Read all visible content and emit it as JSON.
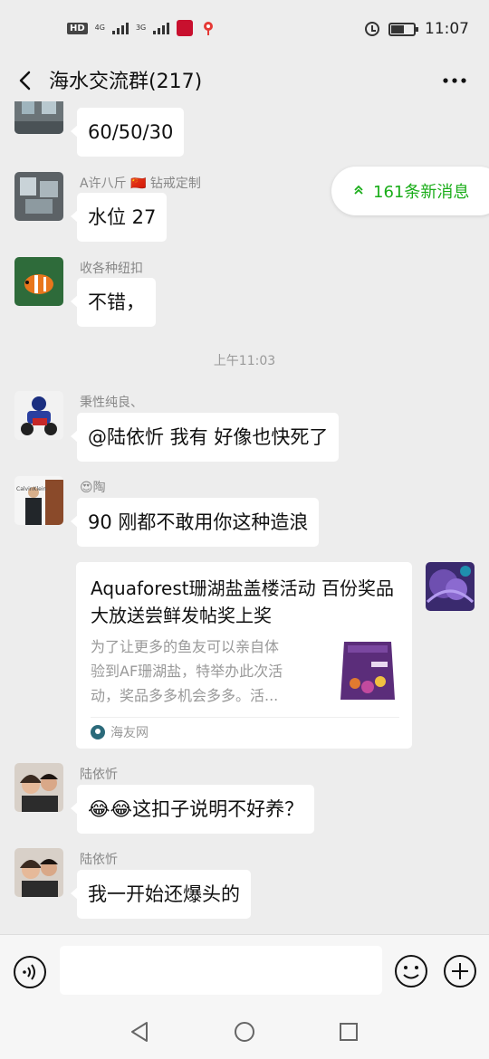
{
  "status_bar": {
    "hd": "HD",
    "sim1": "4G",
    "sim2": "3G",
    "time": "11:07"
  },
  "header": {
    "title": "海水交流群(217)"
  },
  "new_messages": {
    "label": "161条新消息"
  },
  "timestamp": "上午11:03",
  "messages": [
    {
      "sender": "",
      "text": "60/50/30"
    },
    {
      "sender": "A许八斤 🇨🇳 钻戒定制",
      "text": "水位 27"
    },
    {
      "sender": "收各种纽扣",
      "text": "不错，"
    },
    {
      "sender": "秉性纯良、",
      "text": "@陆依忻  我有  好像也快死了"
    },
    {
      "sender": "😍陶",
      "text": "90 刚都不敢用你这种造浪"
    },
    {
      "sender": "陆依忻",
      "text": "😂😂这扣子说明不好养？"
    },
    {
      "sender": "陆依忻",
      "text": "我一开始还爆头的"
    }
  ],
  "link_card": {
    "title": "Aquaforest珊湖盐盖楼活动 百份奖品大放送尝鲜发帖奖上奖",
    "description": "为了让更多的鱼友可以亲自体\n验到AF珊湖盐，特举办此次活\n动，奖品多多机会多多。活...",
    "source": "海友网"
  },
  "input": {
    "placeholder": ""
  },
  "colors": {
    "accent": "#1aad19",
    "background": "#ededed",
    "bubble": "#ffffff"
  }
}
